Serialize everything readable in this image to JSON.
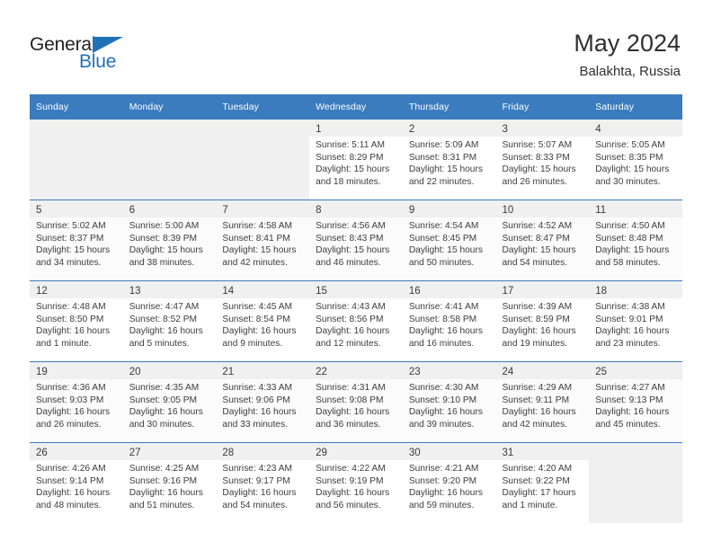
{
  "brand": {
    "name_top": "General",
    "name_bottom": "Blue",
    "accent_color": "#2072b8",
    "header_color": "#3b7cbe"
  },
  "header": {
    "title": "May 2024",
    "subtitle": "Balakhta, Russia"
  },
  "weekday_headers": [
    "Sunday",
    "Monday",
    "Tuesday",
    "Wednesday",
    "Thursday",
    "Friday",
    "Saturday"
  ],
  "weeks": [
    [
      {
        "empty": true
      },
      {
        "empty": true
      },
      {
        "empty": true
      },
      {
        "day": "1",
        "sunrise": "Sunrise: 5:11 AM",
        "sunset": "Sunset: 8:29 PM",
        "daylight_1": "Daylight: 15 hours",
        "daylight_2": "and 18 minutes."
      },
      {
        "day": "2",
        "sunrise": "Sunrise: 5:09 AM",
        "sunset": "Sunset: 8:31 PM",
        "daylight_1": "Daylight: 15 hours",
        "daylight_2": "and 22 minutes."
      },
      {
        "day": "3",
        "sunrise": "Sunrise: 5:07 AM",
        "sunset": "Sunset: 8:33 PM",
        "daylight_1": "Daylight: 15 hours",
        "daylight_2": "and 26 minutes."
      },
      {
        "day": "4",
        "sunrise": "Sunrise: 5:05 AM",
        "sunset": "Sunset: 8:35 PM",
        "daylight_1": "Daylight: 15 hours",
        "daylight_2": "and 30 minutes."
      }
    ],
    [
      {
        "day": "5",
        "sunrise": "Sunrise: 5:02 AM",
        "sunset": "Sunset: 8:37 PM",
        "daylight_1": "Daylight: 15 hours",
        "daylight_2": "and 34 minutes."
      },
      {
        "day": "6",
        "sunrise": "Sunrise: 5:00 AM",
        "sunset": "Sunset: 8:39 PM",
        "daylight_1": "Daylight: 15 hours",
        "daylight_2": "and 38 minutes."
      },
      {
        "day": "7",
        "sunrise": "Sunrise: 4:58 AM",
        "sunset": "Sunset: 8:41 PM",
        "daylight_1": "Daylight: 15 hours",
        "daylight_2": "and 42 minutes."
      },
      {
        "day": "8",
        "sunrise": "Sunrise: 4:56 AM",
        "sunset": "Sunset: 8:43 PM",
        "daylight_1": "Daylight: 15 hours",
        "daylight_2": "and 46 minutes."
      },
      {
        "day": "9",
        "sunrise": "Sunrise: 4:54 AM",
        "sunset": "Sunset: 8:45 PM",
        "daylight_1": "Daylight: 15 hours",
        "daylight_2": "and 50 minutes."
      },
      {
        "day": "10",
        "sunrise": "Sunrise: 4:52 AM",
        "sunset": "Sunset: 8:47 PM",
        "daylight_1": "Daylight: 15 hours",
        "daylight_2": "and 54 minutes."
      },
      {
        "day": "11",
        "sunrise": "Sunrise: 4:50 AM",
        "sunset": "Sunset: 8:48 PM",
        "daylight_1": "Daylight: 15 hours",
        "daylight_2": "and 58 minutes."
      }
    ],
    [
      {
        "day": "12",
        "sunrise": "Sunrise: 4:48 AM",
        "sunset": "Sunset: 8:50 PM",
        "daylight_1": "Daylight: 16 hours",
        "daylight_2": "and 1 minute."
      },
      {
        "day": "13",
        "sunrise": "Sunrise: 4:47 AM",
        "sunset": "Sunset: 8:52 PM",
        "daylight_1": "Daylight: 16 hours",
        "daylight_2": "and 5 minutes."
      },
      {
        "day": "14",
        "sunrise": "Sunrise: 4:45 AM",
        "sunset": "Sunset: 8:54 PM",
        "daylight_1": "Daylight: 16 hours",
        "daylight_2": "and 9 minutes."
      },
      {
        "day": "15",
        "sunrise": "Sunrise: 4:43 AM",
        "sunset": "Sunset: 8:56 PM",
        "daylight_1": "Daylight: 16 hours",
        "daylight_2": "and 12 minutes."
      },
      {
        "day": "16",
        "sunrise": "Sunrise: 4:41 AM",
        "sunset": "Sunset: 8:58 PM",
        "daylight_1": "Daylight: 16 hours",
        "daylight_2": "and 16 minutes."
      },
      {
        "day": "17",
        "sunrise": "Sunrise: 4:39 AM",
        "sunset": "Sunset: 8:59 PM",
        "daylight_1": "Daylight: 16 hours",
        "daylight_2": "and 19 minutes."
      },
      {
        "day": "18",
        "sunrise": "Sunrise: 4:38 AM",
        "sunset": "Sunset: 9:01 PM",
        "daylight_1": "Daylight: 16 hours",
        "daylight_2": "and 23 minutes."
      }
    ],
    [
      {
        "day": "19",
        "sunrise": "Sunrise: 4:36 AM",
        "sunset": "Sunset: 9:03 PM",
        "daylight_1": "Daylight: 16 hours",
        "daylight_2": "and 26 minutes."
      },
      {
        "day": "20",
        "sunrise": "Sunrise: 4:35 AM",
        "sunset": "Sunset: 9:05 PM",
        "daylight_1": "Daylight: 16 hours",
        "daylight_2": "and 30 minutes."
      },
      {
        "day": "21",
        "sunrise": "Sunrise: 4:33 AM",
        "sunset": "Sunset: 9:06 PM",
        "daylight_1": "Daylight: 16 hours",
        "daylight_2": "and 33 minutes."
      },
      {
        "day": "22",
        "sunrise": "Sunrise: 4:31 AM",
        "sunset": "Sunset: 9:08 PM",
        "daylight_1": "Daylight: 16 hours",
        "daylight_2": "and 36 minutes."
      },
      {
        "day": "23",
        "sunrise": "Sunrise: 4:30 AM",
        "sunset": "Sunset: 9:10 PM",
        "daylight_1": "Daylight: 16 hours",
        "daylight_2": "and 39 minutes."
      },
      {
        "day": "24",
        "sunrise": "Sunrise: 4:29 AM",
        "sunset": "Sunset: 9:11 PM",
        "daylight_1": "Daylight: 16 hours",
        "daylight_2": "and 42 minutes."
      },
      {
        "day": "25",
        "sunrise": "Sunrise: 4:27 AM",
        "sunset": "Sunset: 9:13 PM",
        "daylight_1": "Daylight: 16 hours",
        "daylight_2": "and 45 minutes."
      }
    ],
    [
      {
        "day": "26",
        "sunrise": "Sunrise: 4:26 AM",
        "sunset": "Sunset: 9:14 PM",
        "daylight_1": "Daylight: 16 hours",
        "daylight_2": "and 48 minutes."
      },
      {
        "day": "27",
        "sunrise": "Sunrise: 4:25 AM",
        "sunset": "Sunset: 9:16 PM",
        "daylight_1": "Daylight: 16 hours",
        "daylight_2": "and 51 minutes."
      },
      {
        "day": "28",
        "sunrise": "Sunrise: 4:23 AM",
        "sunset": "Sunset: 9:17 PM",
        "daylight_1": "Daylight: 16 hours",
        "daylight_2": "and 54 minutes."
      },
      {
        "day": "29",
        "sunrise": "Sunrise: 4:22 AM",
        "sunset": "Sunset: 9:19 PM",
        "daylight_1": "Daylight: 16 hours",
        "daylight_2": "and 56 minutes."
      },
      {
        "day": "30",
        "sunrise": "Sunrise: 4:21 AM",
        "sunset": "Sunset: 9:20 PM",
        "daylight_1": "Daylight: 16 hours",
        "daylight_2": "and 59 minutes."
      },
      {
        "day": "31",
        "sunrise": "Sunrise: 4:20 AM",
        "sunset": "Sunset: 9:22 PM",
        "daylight_1": "Daylight: 17 hours",
        "daylight_2": "and 1 minute."
      },
      {
        "empty": true
      }
    ]
  ]
}
